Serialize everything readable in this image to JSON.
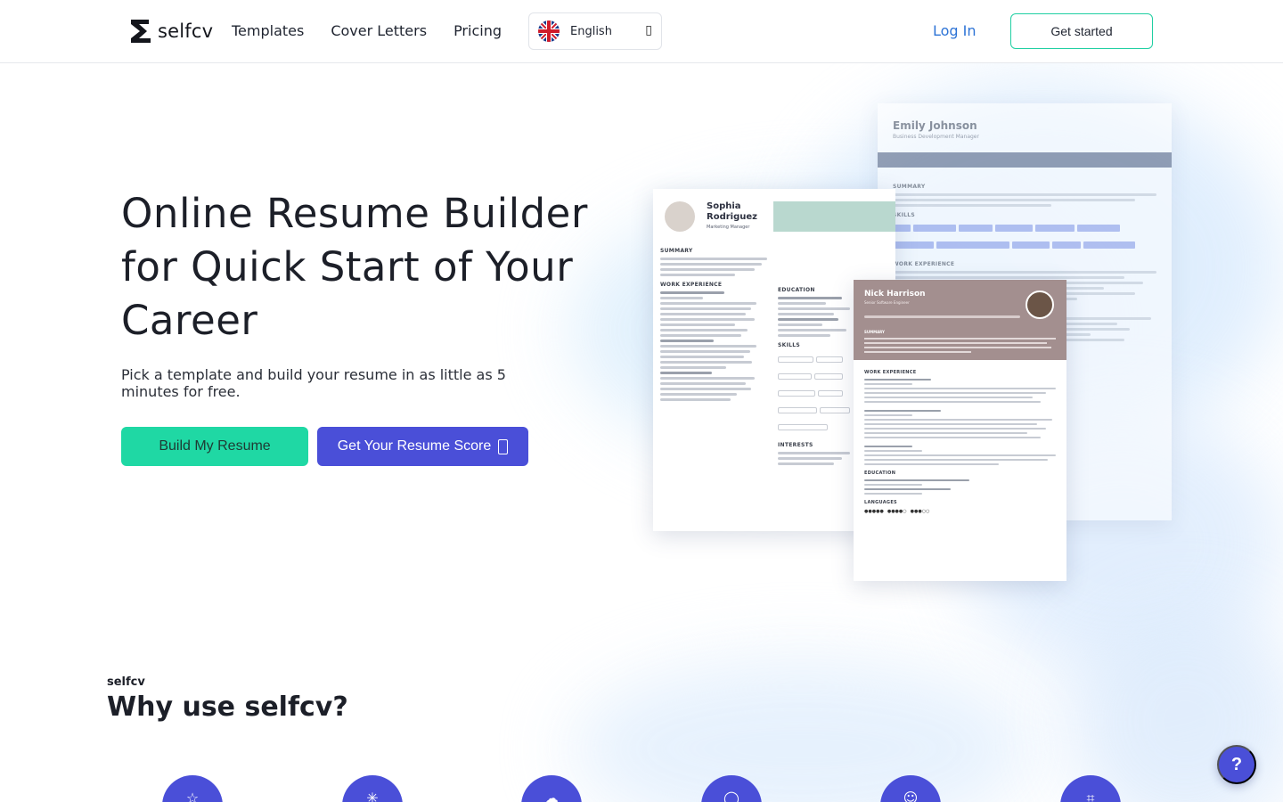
{
  "brand": {
    "name": "selfcv"
  },
  "nav": {
    "items": [
      {
        "label": "Templates"
      },
      {
        "label": "Cover Letters"
      },
      {
        "label": "Pricing"
      }
    ],
    "language": {
      "selected": "English",
      "flag_icon": "uk-flag-icon"
    },
    "login_label": "Log In",
    "get_started_label": "Get started"
  },
  "hero": {
    "title": "Online Resume Builder for Quick Start of Your Career",
    "subtitle": "Pick a template and build your resume in as little as 5 minutes for free.",
    "primary_cta": "Build My Resume",
    "secondary_cta": "Get Your Resume Score"
  },
  "resumes": {
    "emily": {
      "name": "Emily Johnson",
      "role": "Business Development Manager",
      "sections": [
        "SUMMARY",
        "SKILLS",
        "WORK EXPERIENCE"
      ]
    },
    "sophia": {
      "first_name": "Sophia",
      "last_name": "Rodriguez",
      "role": "Marketing Manager",
      "sections": [
        "SUMMARY",
        "WORK EXPERIENCE",
        "EDUCATION",
        "SKILLS",
        "INTERESTS"
      ]
    },
    "nick": {
      "name": "Nick Harrison",
      "role": "Senior Software Engineer",
      "sections": [
        "SUMMARY",
        "WORK EXPERIENCE",
        "EDUCATION",
        "LANGUAGES"
      ]
    }
  },
  "why": {
    "kicker": "selfcv",
    "title_bold": "Why",
    "title_rest": " use selfcv?",
    "feature_icons": [
      "star-icon",
      "sparkle-icon",
      "cloud-icon",
      "chat-icon",
      "smile-icon",
      "share-icon"
    ]
  },
  "help_label": "?",
  "colors": {
    "accent_green": "#1fd8a4",
    "accent_indigo": "#4a4fd8",
    "link_blue": "#2e74d6"
  }
}
